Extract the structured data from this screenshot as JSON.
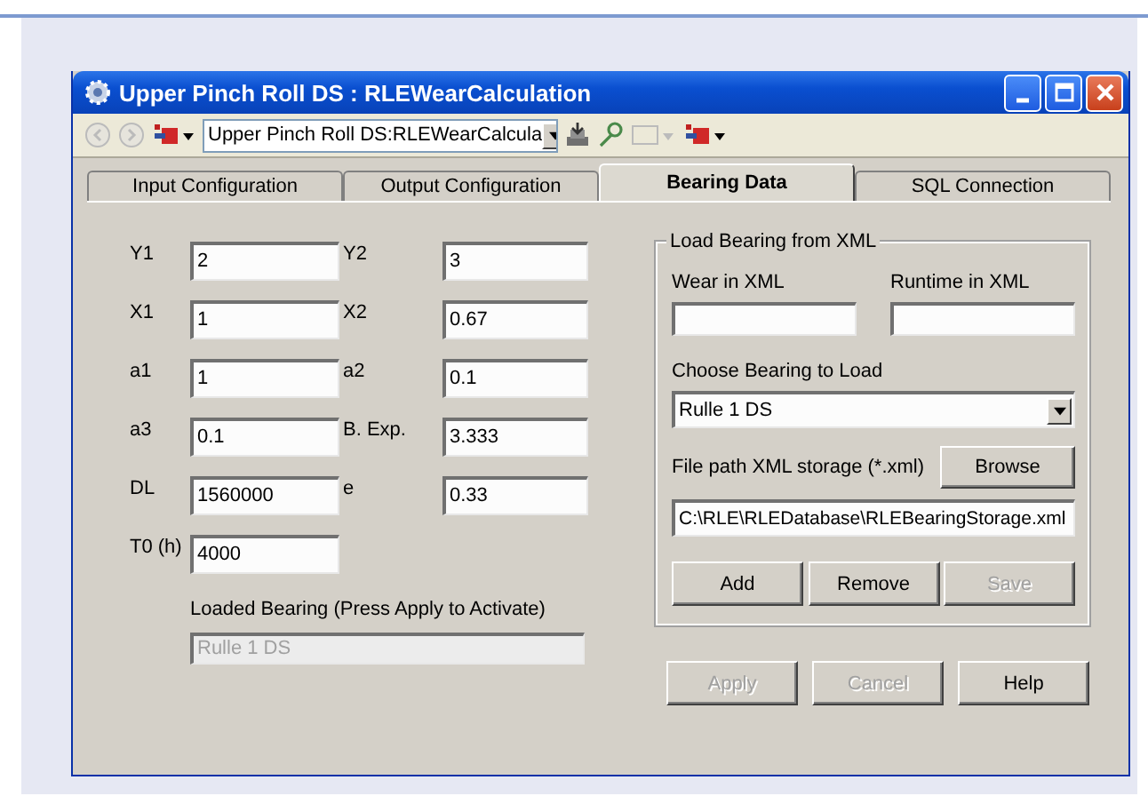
{
  "window": {
    "title": "Upper Pinch Roll DS : RLEWearCalculation"
  },
  "toolbar": {
    "combo": "Upper Pinch Roll DS:RLEWearCalcula"
  },
  "tabs": [
    {
      "label": "Input Configuration",
      "selected": false
    },
    {
      "label": "Output Configuration",
      "selected": false
    },
    {
      "label": "Bearing Data",
      "selected": true
    },
    {
      "label": "SQL Connection",
      "selected": false
    }
  ],
  "fields": [
    {
      "label": "Y1",
      "value": "2"
    },
    {
      "label": "Y2",
      "value": "3"
    },
    {
      "label": "X1",
      "value": "1"
    },
    {
      "label": "X2",
      "value": "0.67"
    },
    {
      "label": "a1",
      "value": "1"
    },
    {
      "label": "a2",
      "value": "0.1"
    },
    {
      "label": "a3",
      "value": "0.1"
    },
    {
      "label": "B. Exp.",
      "value": "3.333"
    },
    {
      "label": "DL",
      "value": "1560000"
    },
    {
      "label": "e",
      "value": "0.33"
    },
    {
      "label": "T0 (h)",
      "value": "4000"
    }
  ],
  "loaded_bearing": {
    "label": "Loaded Bearing (Press Apply to Activate)",
    "value": "Rulle 1 DS",
    "disabled": true
  },
  "xml_group": {
    "title": "Load Bearing from XML",
    "wear_label": "Wear in XML",
    "runtime_label": "Runtime in XML",
    "choose_label": "Choose Bearing to Load",
    "choose_value": "Rulle 1 DS",
    "path_label": "File path XML storage  (*.xml)",
    "browse": "Browse",
    "path_value": "C:\\RLE\\RLEDatabase\\RLEBearingStorage.xml",
    "buttons": [
      {
        "label": "Add",
        "disabled": false
      },
      {
        "label": "Remove",
        "disabled": false
      },
      {
        "label": "Save",
        "disabled": true
      }
    ]
  },
  "buttons": [
    {
      "label": "Apply",
      "disabled": true
    },
    {
      "label": "Cancel",
      "disabled": true
    },
    {
      "label": "Help",
      "disabled": false
    }
  ]
}
